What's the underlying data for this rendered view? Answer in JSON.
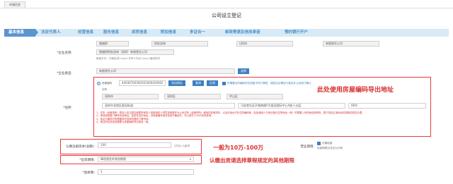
{
  "tab": {
    "label": "申请信息"
  },
  "page": {
    "title": "公司设立登记"
  },
  "steps": [
    "基本信息",
    "法定代表人",
    "经营信息",
    "股东信息",
    "成员信息",
    "附加信息",
    "多证合一",
    "邮政寄递及信用承诺",
    "预约银行开户"
  ],
  "form": {
    "company_name": {
      "label": "*企业名称:",
      "fields": [
        "普遍财",
        "财务咨询",
        "(深圳)",
        "有限责任公司"
      ],
      "composed": "普遍财财务咨询（深圳）有限责任公司",
      "hint": "组成方式：行政区划+(xx)+字号+行业+(xx)+组织形式"
    },
    "company_type": {
      "label": "*企业类型:",
      "value": "有限责任公司",
      "button": "选择"
    },
    "address": {
      "label": "*住所:",
      "radio_label": "房屋编码",
      "code_value": "44030700300161000420002",
      "btn_export": "导出地址",
      "btn_query": "查询",
      "btn_reset": "反馈",
      "cb_text": "所需要住所编码所在层属不同门牌层、楼层住址需自行核实并公安部门确认",
      "row2_label": "住所",
      "region": [
        "深圳市",
        "深圳区",
        "坪山区"
      ],
      "full": "深圳市龙岗区阪田街道",
      "detail": "马安堂社区环城南路5号坂田国际中心A座十五层",
      "room": "08号",
      "notes": [
        "1、住所（经营场所）原则上应当提交房屋所有权人或使用权人同意该房屋作为公司住所（经营场所）使用的证明材料，以及在地址不在住所编码库（包括使用人与商业登记住所地址一致）时需要上传场地证明材料；属于特定区域地址的按相关规定办理。",
        "2、请选择房屋门牌号码或地址；检查导出的地址，对房屋编号相关信息不确定的，可以拨打12345热线查询。",
        "3、地址为楼栋内的需要填写具体的楼层门牌号码。",
        "4、提交的住所信息需要与房屋编码导出信息一致。"
      ]
    },
    "capital": {
      "label": "认缴注册资本(总额):",
      "value": "100",
      "unit": "(万元) 人民币",
      "right_label": "营业期限:",
      "right_check": "长期经营",
      "right_hint": "经营期限应设定为长期"
    },
    "term": {
      "label": "*出资期限:",
      "value": "章程规定的其他期限"
    },
    "copies": {
      "label": "*副本数:",
      "value": "1"
    }
  },
  "annotations": {
    "address": "此处使用房屋编码导出地址",
    "capital": "一般为10万-100万",
    "term": "认缴出资请选择章程规定的其他期限"
  },
  "colors": {
    "accent": "#3d7fc2",
    "annotation": "#d83030",
    "steps_bg": "#d8eaf6"
  }
}
